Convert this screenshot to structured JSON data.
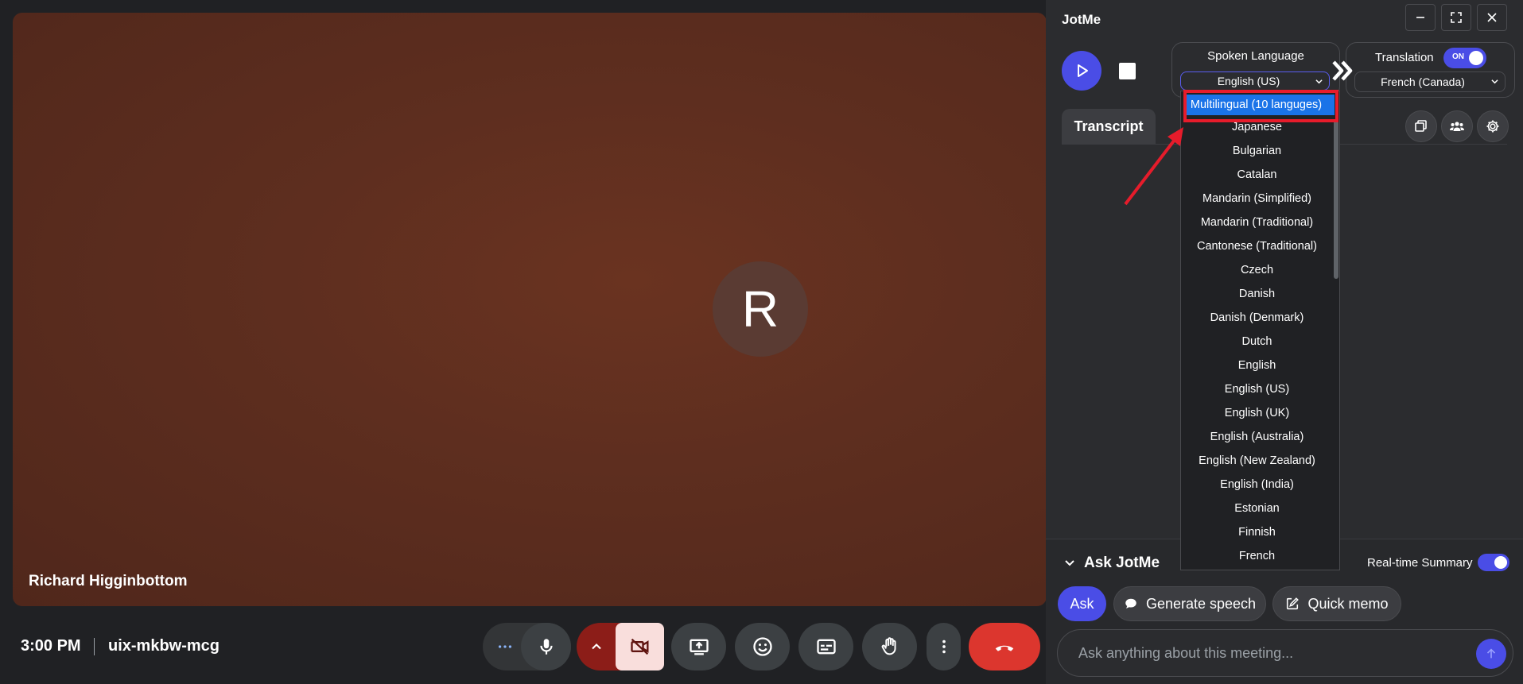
{
  "meeting": {
    "participant_name": "Richard Higginbottom",
    "avatar_letter": "R",
    "time": "3:00 PM",
    "code": "uix-mkbw-mcg"
  },
  "controls": [
    "more-options",
    "microphone",
    "camera-off",
    "present-screen",
    "reactions",
    "captions",
    "raise-hand",
    "more-vert",
    "leave-call"
  ],
  "jotme": {
    "title": "JotMe",
    "spoken_language": {
      "label": "Spoken Language",
      "selected": "English (US)"
    },
    "translation": {
      "label": "Translation",
      "toggle_text": "ON",
      "selected": "French (Canada)"
    },
    "tabs": {
      "transcript": "Transcript"
    },
    "dropdown_options": [
      "Multilingual (10 languges)",
      "Japanese",
      "Bulgarian",
      "Catalan",
      "Mandarin (Simplified)",
      "Mandarin (Traditional)",
      "Cantonese (Traditional)",
      "Czech",
      "Danish",
      "Danish (Denmark)",
      "Dutch",
      "English",
      "English (US)",
      "English (UK)",
      "English (Australia)",
      "English (New Zealand)",
      "English (India)",
      "Estonian",
      "Finnish",
      "French"
    ],
    "highlighted_option": "Multilingual (10 languges)",
    "ask": {
      "header": "Ask JotMe",
      "realtime_summary_label": "Real-time Summary",
      "ask_button": "Ask",
      "generate_speech_button": "Generate speech",
      "quick_memo_button": "Quick memo",
      "input_placeholder": "Ask anything about this meeting..."
    }
  },
  "colors": {
    "accent": "#4a4de6",
    "leave": "#e53935",
    "annotation_red": "#e61c2b",
    "selected_option": "#1a73e8"
  }
}
